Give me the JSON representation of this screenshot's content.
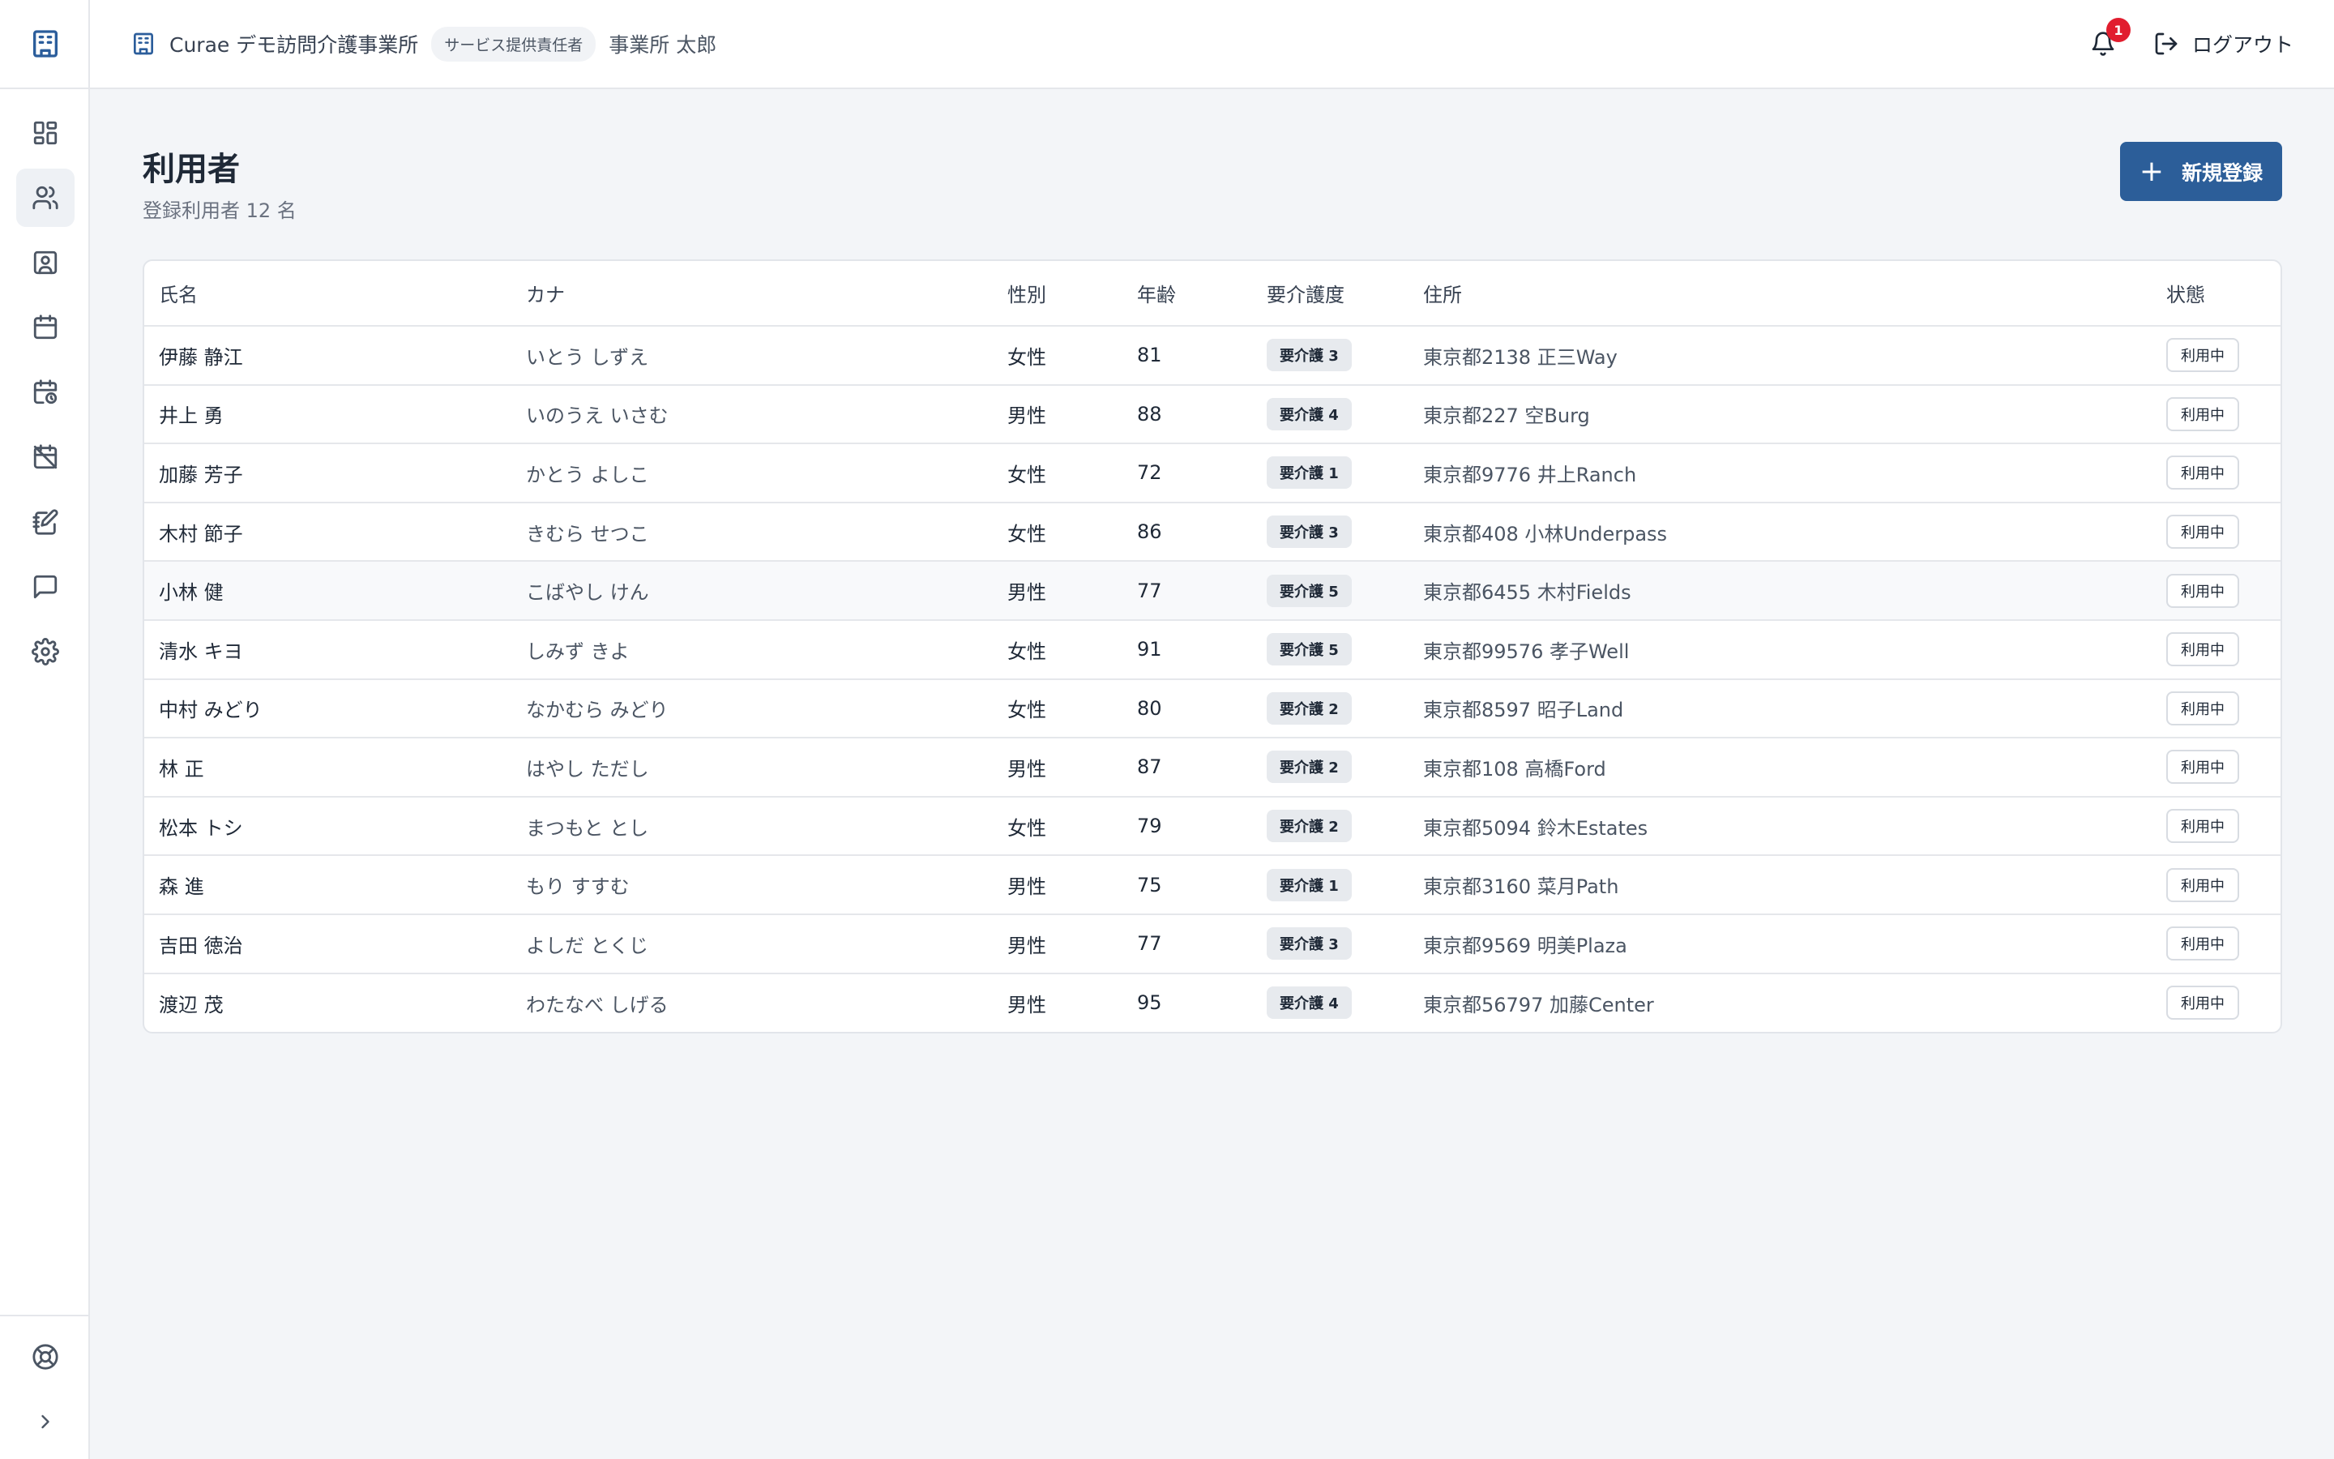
{
  "header": {
    "office_name": "Curae デモ訪問介護事業所",
    "role": "サービス提供責任者",
    "user": "事業所 太郎",
    "notification_count": "1",
    "logout_label": "ログアウト"
  },
  "sidebar": {
    "items": [
      {
        "icon": "dashboard-icon"
      },
      {
        "icon": "users-icon",
        "active": true
      },
      {
        "icon": "contact-card-icon"
      },
      {
        "icon": "calendar-icon"
      },
      {
        "icon": "calendar-clock-icon"
      },
      {
        "icon": "calendar-off-icon"
      },
      {
        "icon": "notebook-pen-icon"
      },
      {
        "icon": "message-icon"
      },
      {
        "icon": "settings-gear-icon"
      }
    ],
    "bottom": [
      {
        "icon": "help-lifebuoy-icon"
      },
      {
        "icon": "chevron-right-icon"
      }
    ]
  },
  "page": {
    "title": "利用者",
    "subtitle": "登録利用者 12 名",
    "new_button": "新規登録"
  },
  "table": {
    "columns": [
      "氏名",
      "カナ",
      "性別",
      "年齢",
      "要介護度",
      "住所",
      "状態"
    ],
    "rows": [
      {
        "name": "伊藤 静江",
        "kana": "いとう しずえ",
        "gender": "女性",
        "age": "81",
        "care": "要介護 3",
        "address": "東京都2138 正三Way",
        "status": "利用中"
      },
      {
        "name": "井上 勇",
        "kana": "いのうえ いさむ",
        "gender": "男性",
        "age": "88",
        "care": "要介護 4",
        "address": "東京都227 空Burg",
        "status": "利用中"
      },
      {
        "name": "加藤 芳子",
        "kana": "かとう よしこ",
        "gender": "女性",
        "age": "72",
        "care": "要介護 1",
        "address": "東京都9776 井上Ranch",
        "status": "利用中"
      },
      {
        "name": "木村 節子",
        "kana": "きむら せつこ",
        "gender": "女性",
        "age": "86",
        "care": "要介護 3",
        "address": "東京都408 小林Underpass",
        "status": "利用中"
      },
      {
        "name": "小林 健",
        "kana": "こばやし けん",
        "gender": "男性",
        "age": "77",
        "care": "要介護 5",
        "address": "東京都6455 木村Fields",
        "status": "利用中"
      },
      {
        "name": "清水 キヨ",
        "kana": "しみず きよ",
        "gender": "女性",
        "age": "91",
        "care": "要介護 5",
        "address": "東京都99576 孝子Well",
        "status": "利用中"
      },
      {
        "name": "中村 みどり",
        "kana": "なかむら みどり",
        "gender": "女性",
        "age": "80",
        "care": "要介護 2",
        "address": "東京都8597 昭子Land",
        "status": "利用中"
      },
      {
        "name": "林 正",
        "kana": "はやし ただし",
        "gender": "男性",
        "age": "87",
        "care": "要介護 2",
        "address": "東京都108 高橋Ford",
        "status": "利用中"
      },
      {
        "name": "松本 トシ",
        "kana": "まつもと とし",
        "gender": "女性",
        "age": "79",
        "care": "要介護 2",
        "address": "東京都5094 鈴木Estates",
        "status": "利用中"
      },
      {
        "name": "森 進",
        "kana": "もり すすむ",
        "gender": "男性",
        "age": "75",
        "care": "要介護 1",
        "address": "東京都3160 菜月Path",
        "status": "利用中"
      },
      {
        "name": "吉田 徳治",
        "kana": "よしだ とくじ",
        "gender": "男性",
        "age": "77",
        "care": "要介護 3",
        "address": "東京都9569 明美Plaza",
        "status": "利用中"
      },
      {
        "name": "渡辺 茂",
        "kana": "わたなべ しげる",
        "gender": "男性",
        "age": "95",
        "care": "要介護 4",
        "address": "東京都56797 加藤Center",
        "status": "利用中"
      }
    ]
  },
  "colors": {
    "accent": "#2c5e99",
    "notification": "#e11d2e"
  }
}
